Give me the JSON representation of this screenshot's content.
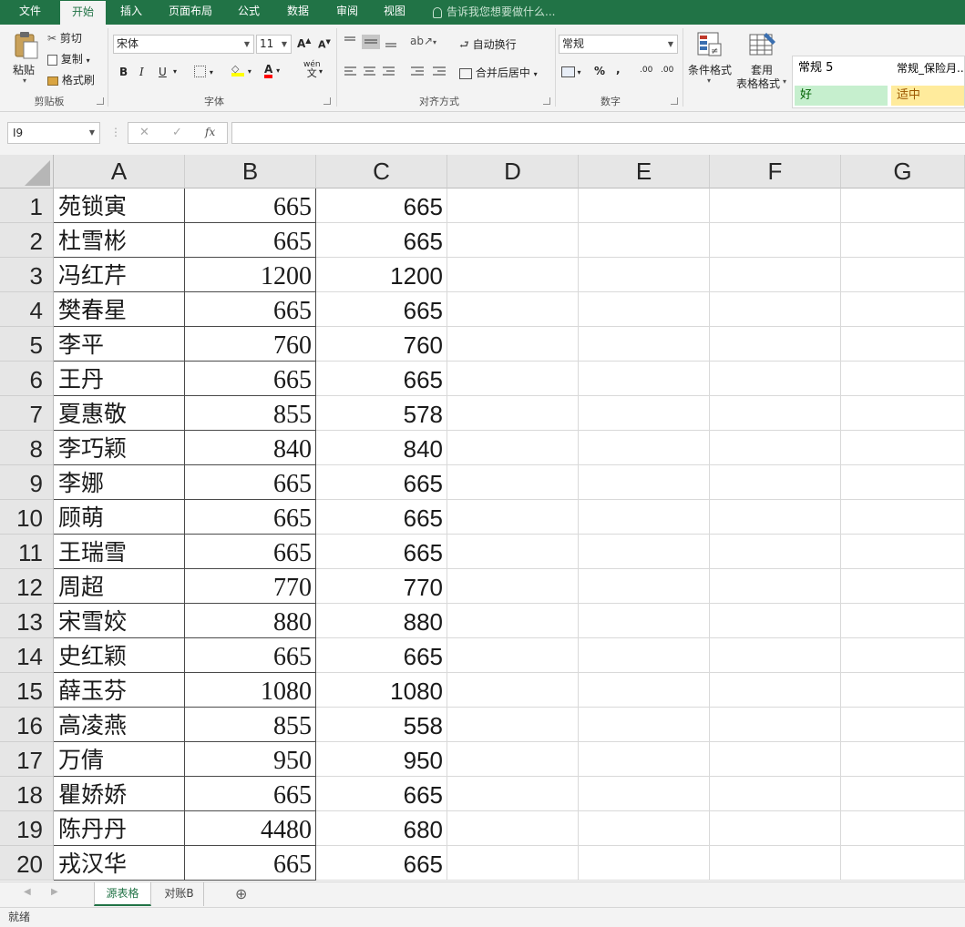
{
  "ribbon_tabs": [
    "文件",
    "开始",
    "插入",
    "页面布局",
    "公式",
    "数据",
    "审阅",
    "视图"
  ],
  "active_tab": "开始",
  "tell_me": "告诉我您想要做什么...",
  "clipboard": {
    "paste": "粘贴",
    "cut": "剪切",
    "copy": "复制",
    "format_painter": "格式刷",
    "label": "剪贴板"
  },
  "font": {
    "name": "宋体",
    "size": "11",
    "bold": "B",
    "italic": "I",
    "underline": "U",
    "grow": "A",
    "shrink": "A",
    "color_letter": "A",
    "phonetic": "wén",
    "phonetic_char": "文",
    "label": "字体"
  },
  "alignment": {
    "wrap_text": "自动换行",
    "merge_center": "合并后居中",
    "label": "对齐方式"
  },
  "number": {
    "format": "常规",
    "percent": "%",
    "comma": ",",
    "inc_decimal": ".00",
    "dec_decimal": ".00",
    "label": "数字"
  },
  "styles": {
    "conditional_format": "条件格式",
    "format_as_table_1": "套用",
    "format_as_table_2": "表格格式",
    "gallery": [
      "常规 5",
      "常规_保险月..",
      "好",
      "适中"
    ]
  },
  "formula_bar": {
    "name_box": "I9",
    "fx": "fx",
    "cancel": "✕",
    "confirm": "✓",
    "content": ""
  },
  "columns": [
    "A",
    "B",
    "C",
    "D",
    "E",
    "F",
    "G"
  ],
  "rows": [
    {
      "n": "1",
      "a": "苑锁寅",
      "b": "665",
      "c": "665"
    },
    {
      "n": "2",
      "a": "杜雪彬",
      "b": "665",
      "c": "665"
    },
    {
      "n": "3",
      "a": "冯红芹",
      "b": "1200",
      "c": "1200"
    },
    {
      "n": "4",
      "a": "樊春星",
      "b": "665",
      "c": "665"
    },
    {
      "n": "5",
      "a": "李平",
      "b": "760",
      "c": "760"
    },
    {
      "n": "6",
      "a": "王丹",
      "b": "665",
      "c": "665"
    },
    {
      "n": "7",
      "a": "夏惠敬",
      "b": "855",
      "c": "578"
    },
    {
      "n": "8",
      "a": "李巧颖",
      "b": "840",
      "c": "840"
    },
    {
      "n": "9",
      "a": "李娜",
      "b": "665",
      "c": "665"
    },
    {
      "n": "10",
      "a": "顾萌",
      "b": "665",
      "c": "665"
    },
    {
      "n": "11",
      "a": "王瑞雪",
      "b": "665",
      "c": "665"
    },
    {
      "n": "12",
      "a": "周超",
      "b": "770",
      "c": "770"
    },
    {
      "n": "13",
      "a": "宋雪姣",
      "b": "880",
      "c": "880"
    },
    {
      "n": "14",
      "a": "史红颖",
      "b": "665",
      "c": "665"
    },
    {
      "n": "15",
      "a": "薛玉芬",
      "b": "1080",
      "c": "1080"
    },
    {
      "n": "16",
      "a": "高凌燕",
      "b": "855",
      "c": "558"
    },
    {
      "n": "17",
      "a": "万倩",
      "b": "950",
      "c": "950"
    },
    {
      "n": "18",
      "a": "瞿娇娇",
      "b": "665",
      "c": "665"
    },
    {
      "n": "19",
      "a": "陈丹丹",
      "b": "4480",
      "c": "680"
    },
    {
      "n": "20",
      "a": "戎汉华",
      "b": "665",
      "c": "665"
    }
  ],
  "sheets": [
    "源表格",
    "对账B"
  ],
  "active_sheet": "源表格",
  "add_sheet": "⊕",
  "status": "就绪",
  "colors": {
    "brand_green": "#217346",
    "good_fill": "#c6efce",
    "good_text": "#006100",
    "neutral_fill": "#ffeb9c",
    "neutral_text": "#9c5700"
  }
}
